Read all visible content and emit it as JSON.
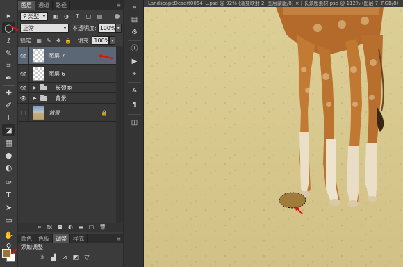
{
  "toolbar": {
    "tools": [
      "move-tool",
      "elliptical-marquee-tool",
      "lasso-tool",
      "quick-selection-tool",
      "crop-tool",
      "eyedropper-tool",
      "spot-healing-brush-tool",
      "brush-tool",
      "clone-stamp-tool",
      "history-brush-tool",
      "eraser-tool",
      "gradient-tool",
      "blur-tool",
      "dodge-tool",
      "pen-tool",
      "type-tool",
      "path-selection-tool",
      "rectangle-tool",
      "hand-tool",
      "zoom-tool"
    ],
    "foreground_color": "#a07430",
    "background_color": "#ffffff"
  },
  "layers_panel": {
    "tabs": [
      "图层",
      "通道",
      "路径"
    ],
    "active_tab": "图层",
    "filter_kind": "类型",
    "blend_mode": "正常",
    "opacity_label": "不透明度:",
    "opacity_value": "100%",
    "lock_label": "锁定:",
    "fill_label": "填充:",
    "fill_value": "100%",
    "layers": [
      {
        "name": "图层 7",
        "type": "pixel",
        "selected": true,
        "visible": true
      },
      {
        "name": "图层 6",
        "type": "pixel",
        "selected": false,
        "visible": true
      },
      {
        "name": "长颈鹿",
        "type": "group",
        "selected": false,
        "visible": true
      },
      {
        "name": "背景",
        "type": "group",
        "selected": false,
        "visible": true
      },
      {
        "name": "背景",
        "type": "background",
        "selected": false,
        "visible": false,
        "locked": true
      }
    ]
  },
  "adjustments_panel": {
    "tabs": [
      "颜色",
      "色板",
      "调整",
      "样式"
    ],
    "active_tab": "调整",
    "title": "添加调整"
  },
  "document": {
    "tab_title": "LandscapeDesert0054_L.psd @ 92% (渐变映射 2, 图层蒙版/8) × | 长颈鹿素材.psd @ 112% (图层 7, RGB/8)"
  },
  "colors": {
    "sand": "#d8c98e",
    "selection_fill": "#a07b3a",
    "annotation_arrow": "#e01010",
    "selected_layer": "#5c6775"
  }
}
